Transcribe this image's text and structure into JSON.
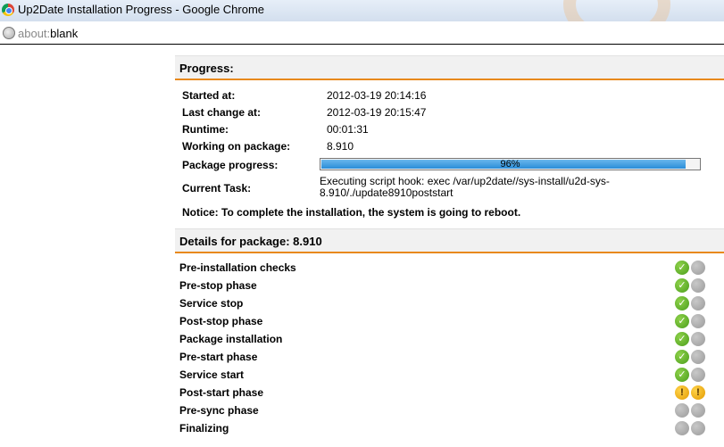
{
  "window": {
    "title": "Up2Date Installation Progress - Google Chrome"
  },
  "address": {
    "scheme": "about:",
    "rest": "blank"
  },
  "progress_section": {
    "heading": "Progress:",
    "fields": [
      {
        "label": "Started at:",
        "value": "2012-03-19 20:14:16"
      },
      {
        "label": "Last change at:",
        "value": "2012-03-19 20:15:47"
      },
      {
        "label": "Runtime:",
        "value": "00:01:31"
      },
      {
        "label": "Working on package:",
        "value": "8.910"
      }
    ],
    "package_progress": {
      "label": "Package progress:",
      "percent": 96,
      "text": "96%"
    },
    "current_task": {
      "label": "Current Task:",
      "value": "Executing script hook: exec /var/up2date//sys-install/u2d-sys-8.910/./update8910poststart"
    },
    "notice": "Notice: To complete the installation, the system is going to reboot."
  },
  "details_section": {
    "heading": "Details for package: 8.910",
    "steps": [
      {
        "label": "Pre-installation checks",
        "status": [
          "ok",
          "pending"
        ]
      },
      {
        "label": "Pre-stop phase",
        "status": [
          "ok",
          "pending"
        ]
      },
      {
        "label": "Service stop",
        "status": [
          "ok",
          "pending"
        ]
      },
      {
        "label": "Post-stop phase",
        "status": [
          "ok",
          "pending"
        ]
      },
      {
        "label": "Package installation",
        "status": [
          "ok",
          "pending"
        ]
      },
      {
        "label": "Pre-start phase",
        "status": [
          "ok",
          "pending"
        ]
      },
      {
        "label": "Service start",
        "status": [
          "ok",
          "pending"
        ]
      },
      {
        "label": "Post-start phase",
        "status": [
          "warn",
          "warn"
        ]
      },
      {
        "label": "Pre-sync phase",
        "status": [
          "pending",
          "pending"
        ]
      },
      {
        "label": "Finalizing",
        "status": [
          "pending",
          "pending"
        ]
      }
    ]
  },
  "icons": {
    "ok": "checkmark-icon",
    "warn": "exclamation-icon",
    "pending": "pending-icon"
  },
  "colors": {
    "accent": "#e8891c",
    "progress": "#2a8dd8",
    "ok": "#4a9e1c",
    "warn": "#e39a00",
    "pending": "#9a9a9a"
  }
}
